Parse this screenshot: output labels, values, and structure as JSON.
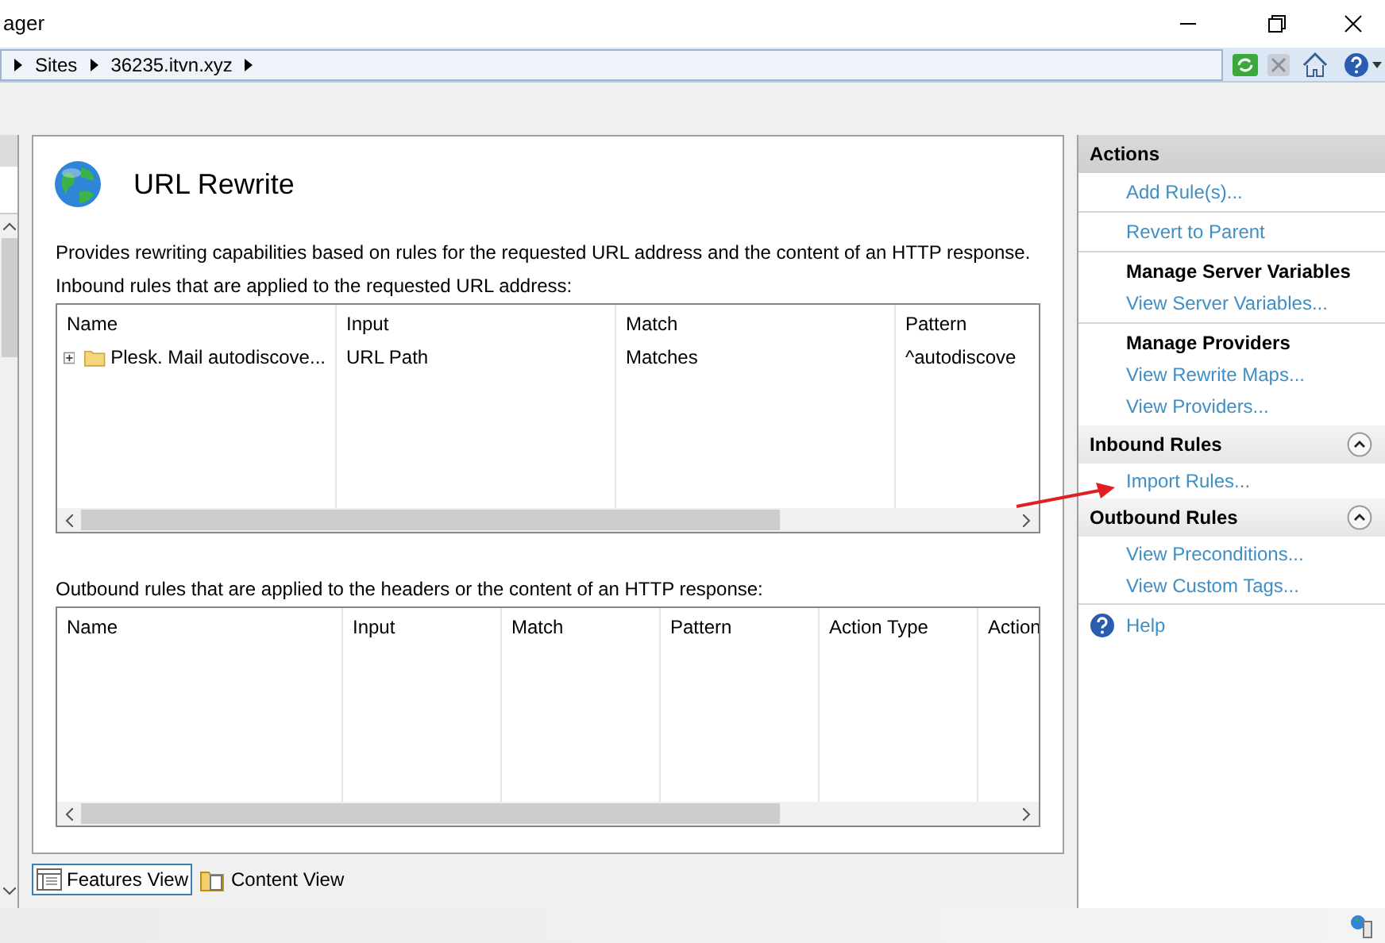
{
  "window": {
    "title": "ager"
  },
  "breadcrumb": [
    "Sites",
    "36235.itvn.xyz"
  ],
  "feature": {
    "title": "URL Rewrite",
    "description": "Provides rewriting capabilities based on rules for the requested URL address and the content of an HTTP response.",
    "inbound": {
      "label": "Inbound rules that are applied to the requested URL address:",
      "columns": [
        "Name",
        "Input",
        "Match",
        "Pattern"
      ],
      "rows": [
        {
          "name": "Plesk. Mail autodiscove...",
          "input": "URL Path",
          "match": "Matches",
          "pattern": "^autodiscove",
          "expanded": false
        }
      ]
    },
    "outbound": {
      "label": "Outbound rules that are applied to the headers or the content of an HTTP response:",
      "columns": [
        "Name",
        "Input",
        "Match",
        "Pattern",
        "Action Type",
        "Action"
      ]
    }
  },
  "view_tabs": [
    {
      "label": "Features View",
      "selected": true
    },
    {
      "label": "Content View",
      "selected": false
    }
  ],
  "actions": {
    "title": "Actions",
    "groups": [
      {
        "links": [
          "Add Rule(s)..."
        ]
      },
      {
        "links": [
          "Revert to Parent"
        ]
      },
      {
        "heading": "Manage Server Variables",
        "links": [
          "View Server Variables..."
        ]
      },
      {
        "heading": "Manage Providers",
        "links": [
          "View Rewrite Maps...",
          "View Providers..."
        ]
      }
    ],
    "sections": [
      {
        "title": "Inbound Rules",
        "expanded": true,
        "links": [
          "Import Rules..."
        ]
      },
      {
        "title": "Outbound Rules",
        "expanded": true,
        "links": [
          "View Preconditions...",
          "View Custom Tags..."
        ]
      }
    ],
    "help": "Help"
  }
}
